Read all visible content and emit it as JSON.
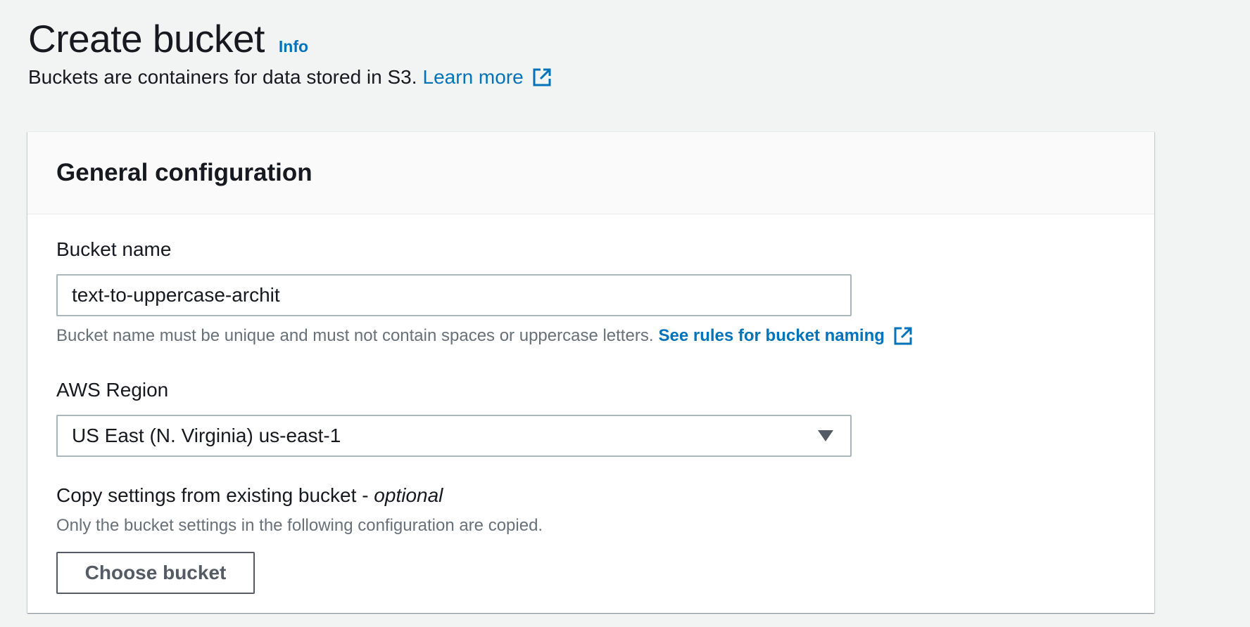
{
  "header": {
    "title": "Create bucket",
    "info_label": "Info",
    "description": "Buckets are containers for data stored in S3.",
    "learn_more_label": "Learn more"
  },
  "general_configuration": {
    "title": "General configuration",
    "bucket_name": {
      "label": "Bucket name",
      "value": "text-to-uppercase-archit",
      "constraint": "Bucket name must be unique and must not contain spaces or uppercase letters.",
      "rules_link_label": "See rules for bucket naming"
    },
    "aws_region": {
      "label": "AWS Region",
      "selected": "US East (N. Virginia) us-east-1"
    },
    "copy_settings": {
      "label": "Copy settings from existing bucket -",
      "label_optional": "optional",
      "description": "Only the bucket settings in the following configuration are copied.",
      "button_label": "Choose bucket"
    }
  },
  "icons": {
    "external_link": "external-link-icon",
    "dropdown_caret": "caret-down-icon"
  },
  "colors": {
    "link": "#0073bb",
    "background": "#f2f3f3",
    "text": "#16191f",
    "secondary_text": "#687078"
  }
}
